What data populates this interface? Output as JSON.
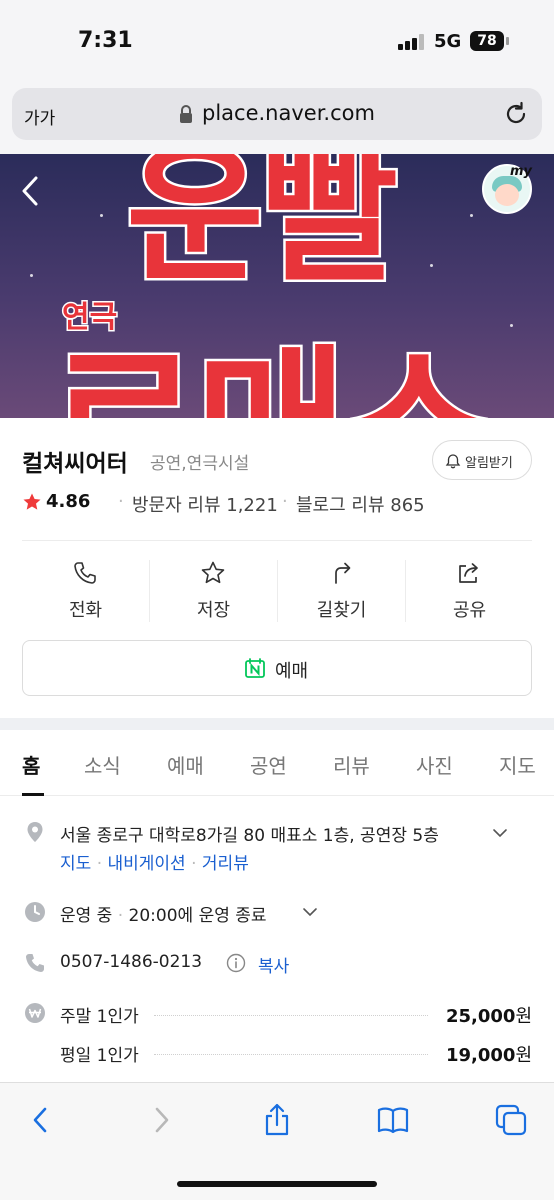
{
  "status_bar": {
    "time": "7:31",
    "network": "5G",
    "battery": "78"
  },
  "browser": {
    "text_size_button": "가가",
    "url": "place.naver.com"
  },
  "hero": {
    "title_line1": "운빨",
    "title_small": "연극",
    "title_line2": "로매스"
  },
  "place": {
    "name": "컬쳐씨어터",
    "category": "공연,연극시설",
    "alarm_label": "알림받기",
    "rating": "4.86",
    "visitor_reviews": "방문자 리뷰 1,221",
    "blog_reviews": "블로그 리뷰 865"
  },
  "actions": [
    {
      "label": "전화",
      "icon": "phone-icon"
    },
    {
      "label": "저장",
      "icon": "star-icon"
    },
    {
      "label": "길찾기",
      "icon": "directions-icon"
    },
    {
      "label": "공유",
      "icon": "share-icon"
    }
  ],
  "booking": {
    "label": "예매",
    "icon": "naver-booking-icon"
  },
  "tabs": [
    "홈",
    "소식",
    "예매",
    "공연",
    "리뷰",
    "사진",
    "지도"
  ],
  "details": {
    "address": "서울 종로구 대학로8가길 80 매표소 1층, 공연장 5층",
    "address_links": [
      "지도",
      "내비게이션",
      "거리뷰"
    ],
    "status": "운영 중",
    "hours": "20:00에 운영 종료",
    "phone": "0507-1486-0213",
    "copy_label": "복사",
    "prices": [
      {
        "label": "주말 1인가",
        "amount": "25,000",
        "unit": "원"
      },
      {
        "label": "평일 1인가",
        "amount": "19,000",
        "unit": "원"
      }
    ]
  },
  "colors": {
    "accent_red": "#e8343a",
    "link_blue": "#1a5fd0",
    "naver_green": "#03c75a"
  }
}
